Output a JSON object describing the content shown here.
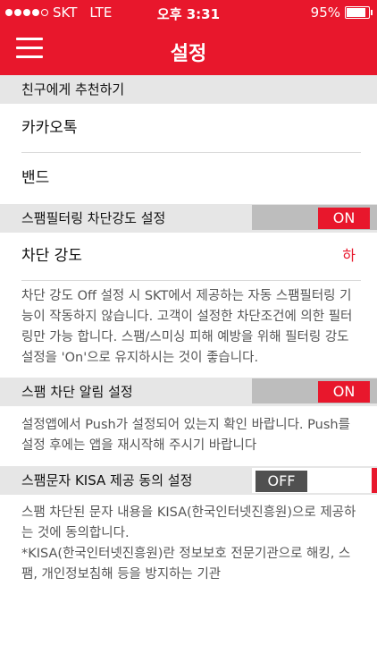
{
  "status_bar": {
    "carrier": "SKT",
    "network": "LTE",
    "time": "오후 3:31",
    "battery": "95%",
    "battery_level": 0.95
  },
  "nav": {
    "title": "설정"
  },
  "recommend": {
    "header": "친구에게 추천하기",
    "items": [
      "카카오톡",
      "밴드"
    ]
  },
  "spam_filter": {
    "header": "스팸필터링 차단강도 설정",
    "toggle_label": "ON",
    "strength_label": "차단 강도",
    "strength_value": "하",
    "description": "차단 강도 Off 설정 시 SKT에서 제공하는 자동 스팸필터링 기능이 작동하지 않습니다. 고객이 설정한 차단조건에 의한 필터링만 가능 합니다. 스팸/스미싱 피해 예방을 위해 필터링 강도 설정을 'On'으로 유지하시는 것이 좋습니다."
  },
  "spam_alert": {
    "header": "스팸 차단 알림 설정",
    "toggle_label": "ON",
    "description": "설정앱에서 Push가 설정되어 있는지 확인 바랍니다. Push를 설정 후에는 앱을 재시작해 주시기 바랍니다"
  },
  "kisa": {
    "header": "스팸문자 KISA 제공 동의 설정",
    "toggle_label": "OFF",
    "description": "스팸 차단된 문자 내용을 KISA(한국인터넷진흥원)으로 제공하는 것에 동의합니다.\n*KISA(한국인터넷진흥원)란 정보보호 전문기관으로 해킹, 스팸, 개인정보침해 등을 방지하는 기관"
  },
  "colors": {
    "accent": "#e8172c",
    "header_bg": "#e6e6e6",
    "toggle_track": "#bdbdbd",
    "toggle_off_knob": "#505050"
  }
}
